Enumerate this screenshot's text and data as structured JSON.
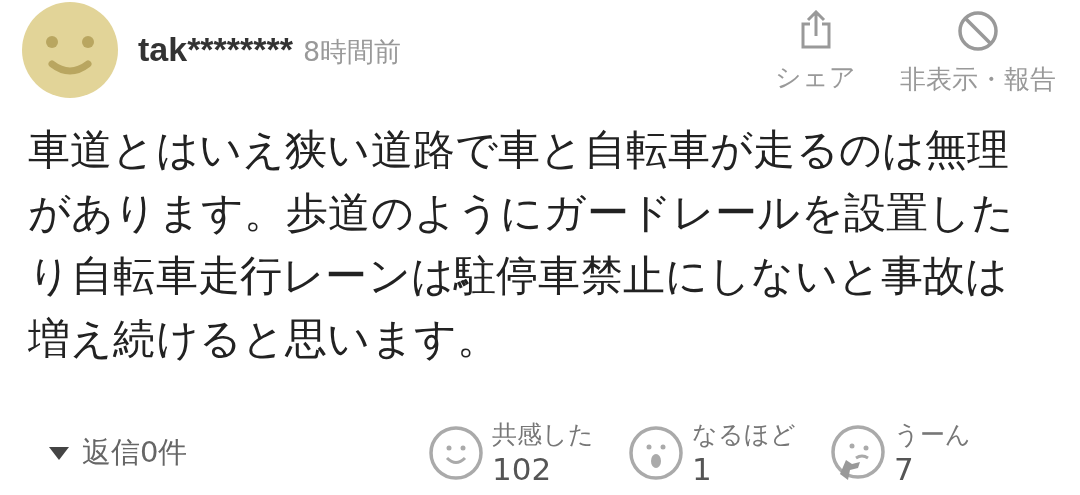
{
  "comment": {
    "author": "tak********",
    "time": "8時間前",
    "body": "車道とはいえ狭い道路で車と自転車が走るのは無理があります。歩道のようにガードレールを設置したり自転車走行レーンは駐停車禁止にしないと事故は増え続けると思います。"
  },
  "actions": [
    {
      "kind": "share",
      "label": "シェア"
    },
    {
      "kind": "hide",
      "label": "非表示・報告"
    }
  ],
  "replies": {
    "label": "返信0件",
    "expanded": false
  },
  "reactions": [
    {
      "kind": "smile",
      "label": "共感した",
      "count": "102"
    },
    {
      "kind": "surprised",
      "label": "なるほど",
      "count": "1"
    },
    {
      "kind": "thinking",
      "label": "うーん",
      "count": "7"
    }
  ]
}
